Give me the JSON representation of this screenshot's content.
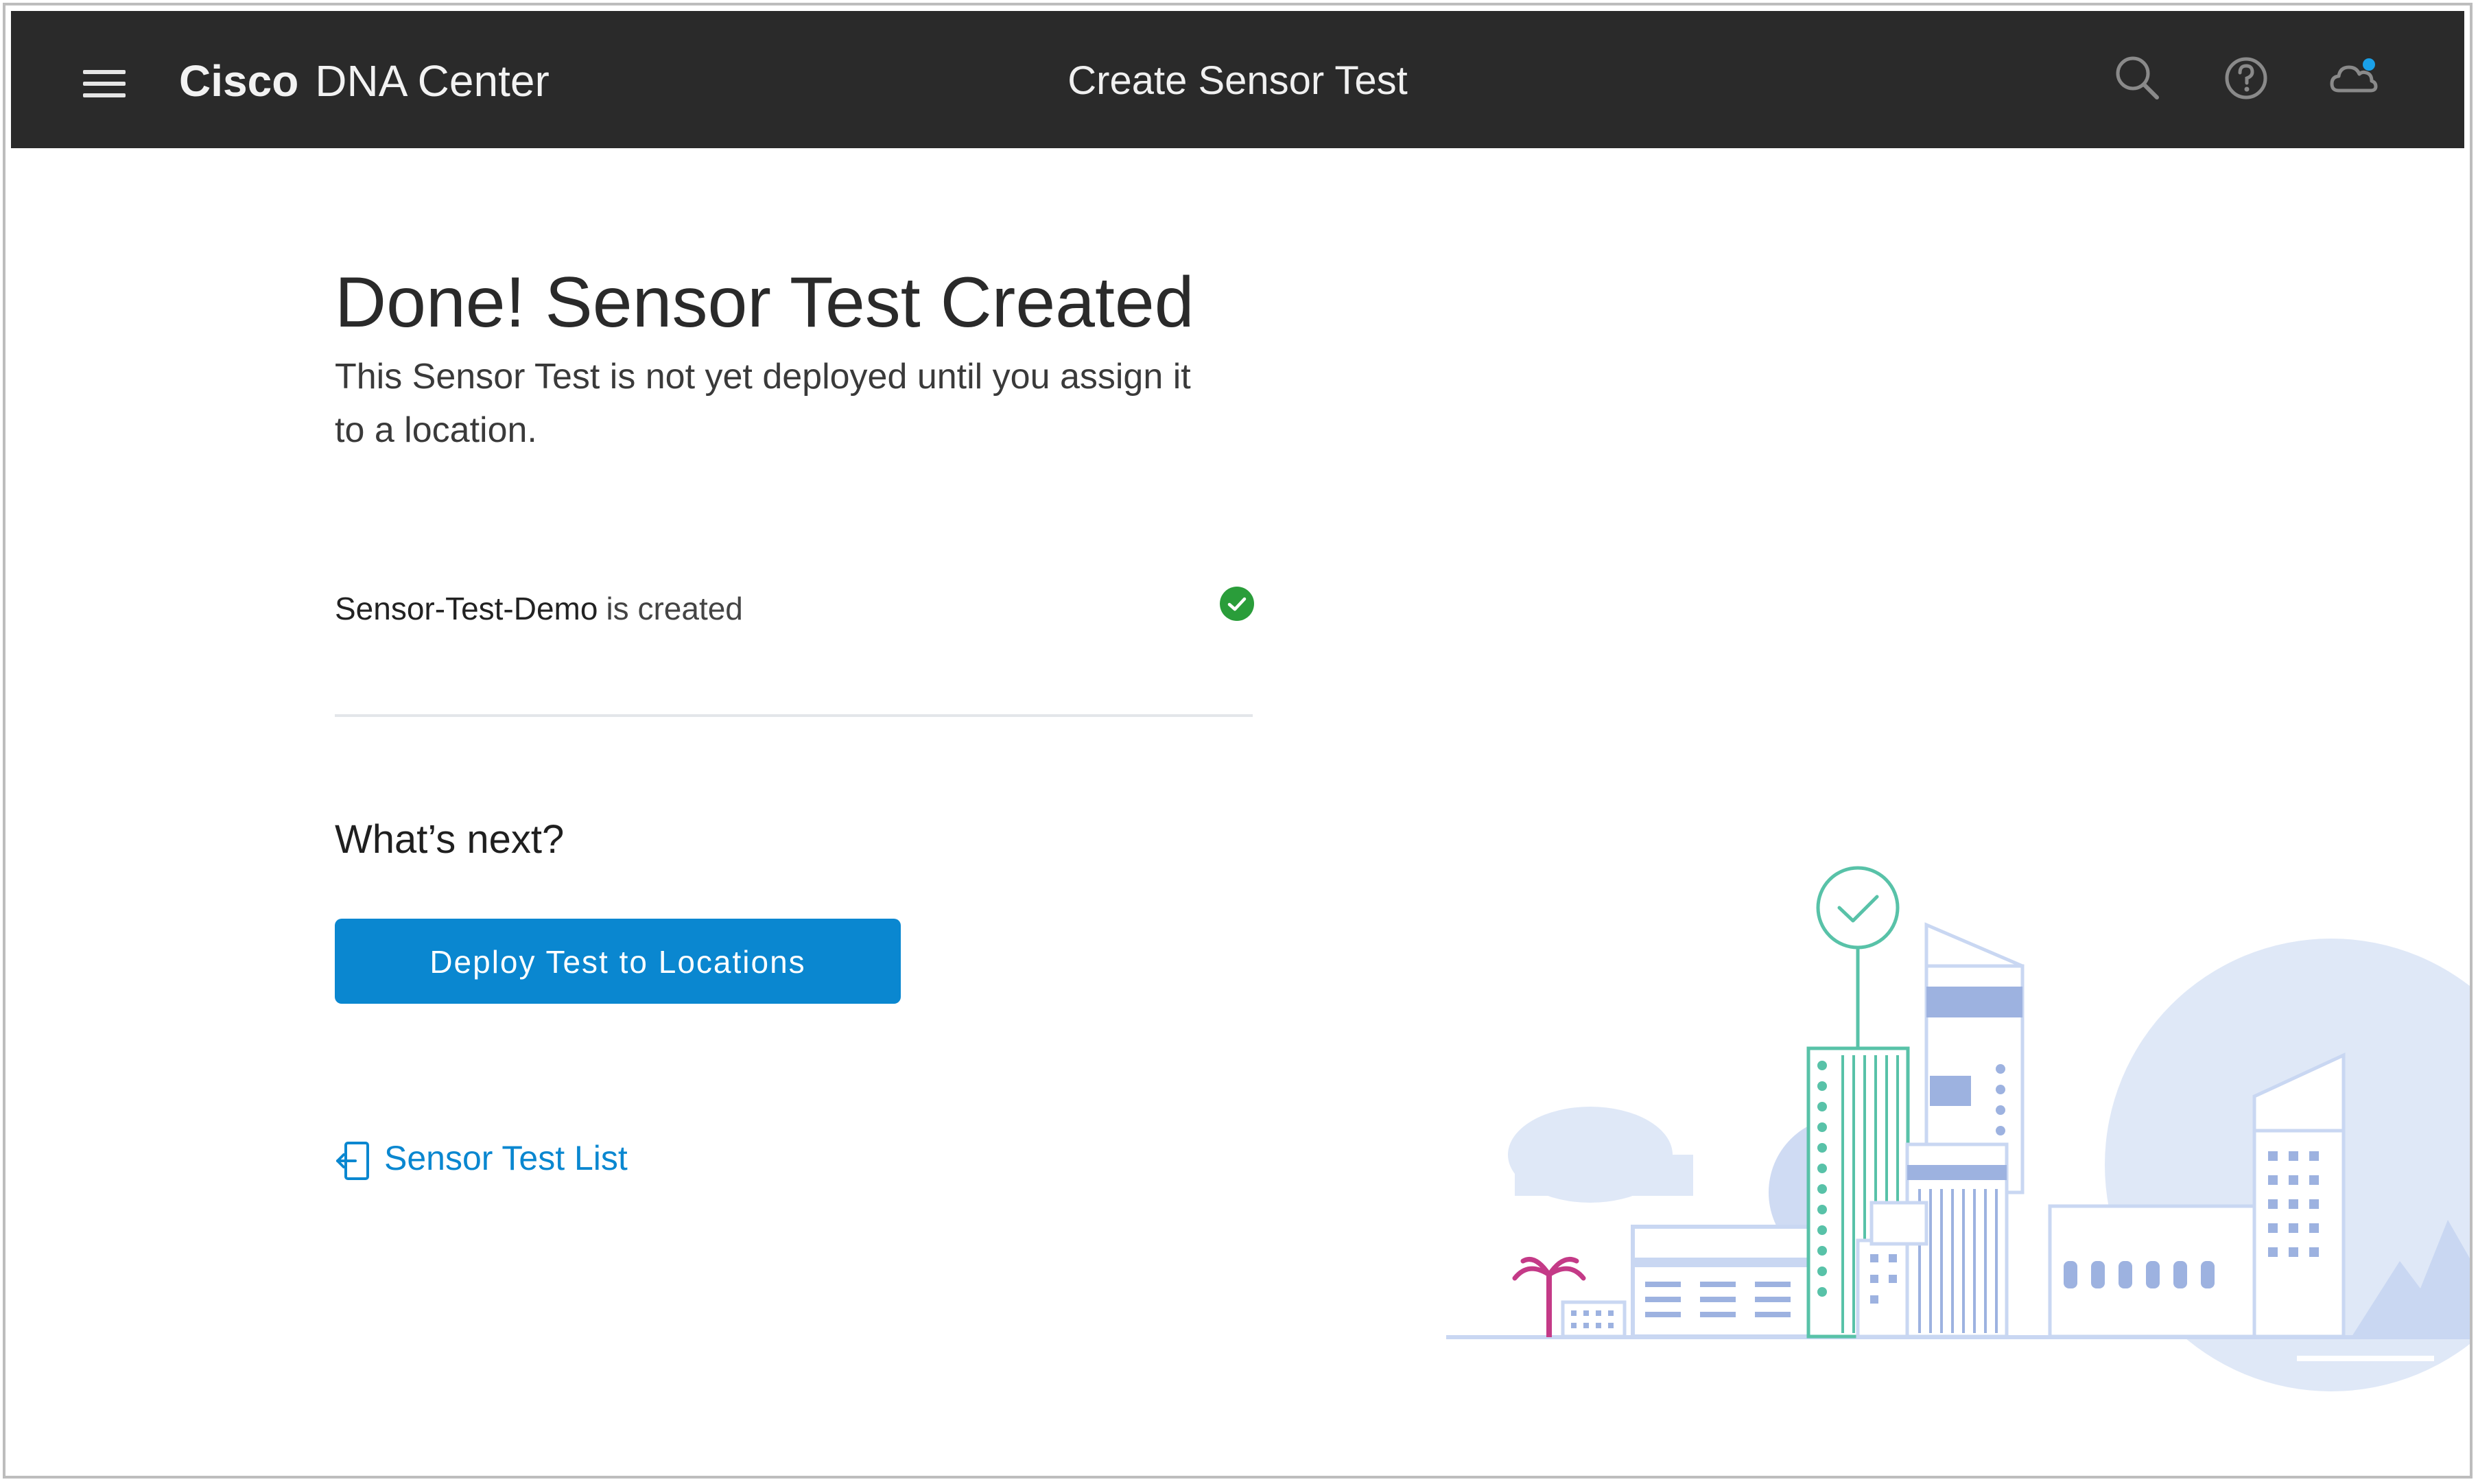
{
  "header": {
    "brand_bold": "Cisco",
    "brand_rest": "DNA Center",
    "title": "Create Sensor Test"
  },
  "main": {
    "heading": "Done! Sensor Test Created",
    "description": "This Sensor Test is not yet deployed until you assign it to a location.",
    "created_item": {
      "name": "Sensor-Test-Demo",
      "suffix": "is created"
    },
    "next_heading": "What’s next?",
    "deploy_button_label": "Deploy Test to Locations",
    "list_link_label": "Sensor Test List"
  },
  "colors": {
    "topbar": "#2a2a2a",
    "accent": "#0a87d0",
    "success": "#2a9d3a",
    "illustration_blue": "#c9d7f2",
    "illustration_teal": "#58c2a8"
  },
  "icons": [
    "menu-icon",
    "search-icon",
    "help-icon",
    "cloud-icon",
    "check-circle-icon",
    "back-to-list-icon",
    "city-illustration"
  ]
}
